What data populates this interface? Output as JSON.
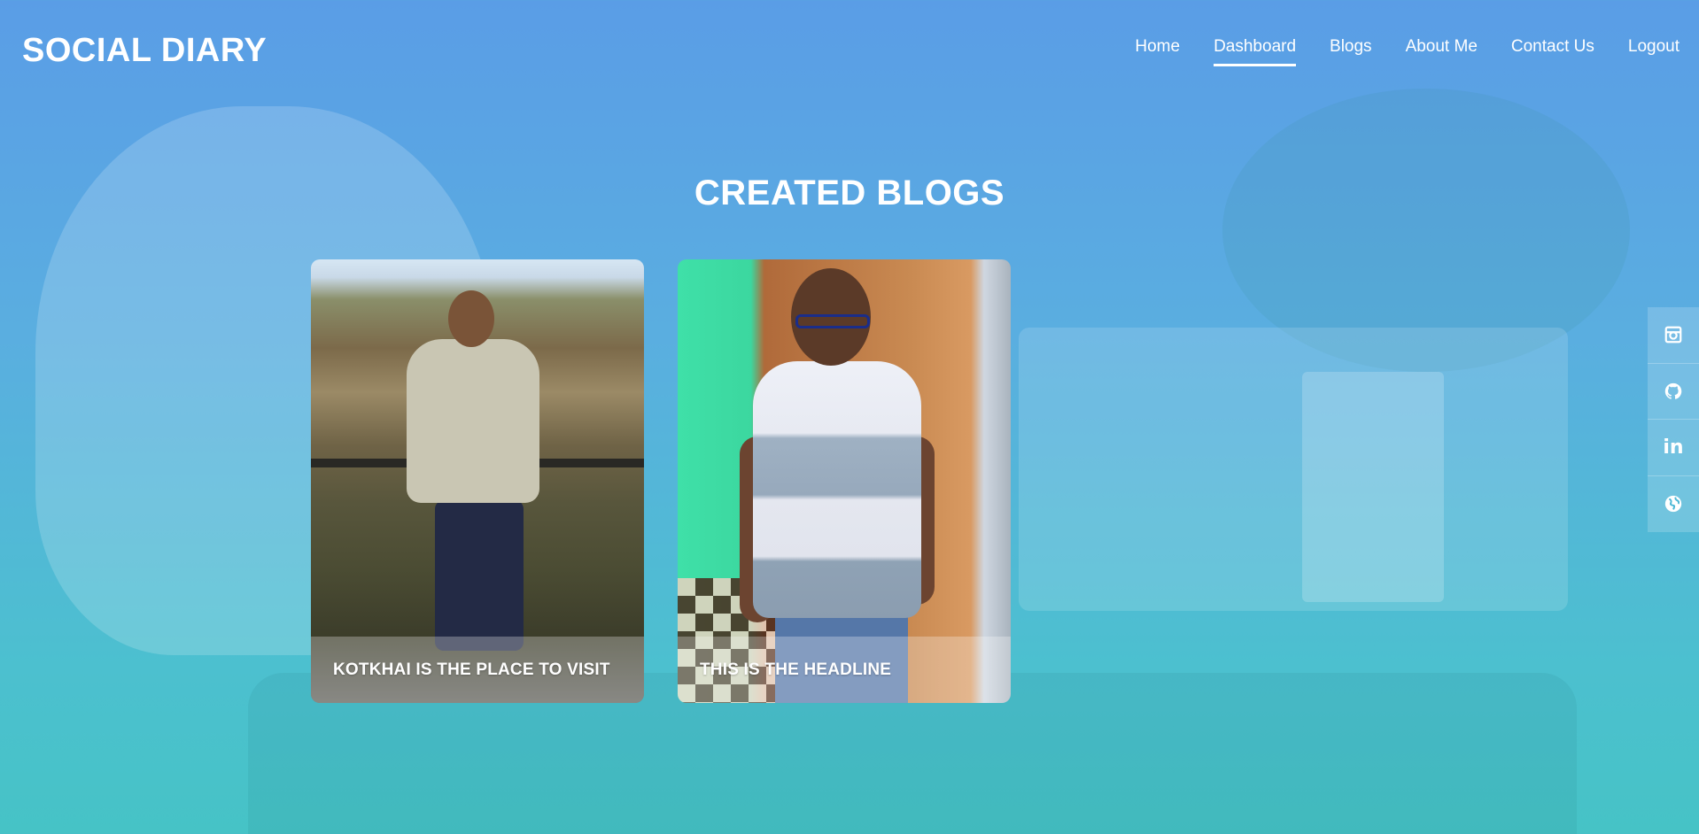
{
  "brand": {
    "title": "SOCIAL DIARY"
  },
  "nav": {
    "items": [
      {
        "label": "Home",
        "active": false
      },
      {
        "label": "Dashboard",
        "active": true
      },
      {
        "label": "Blogs",
        "active": false
      },
      {
        "label": "About Me",
        "active": false
      },
      {
        "label": "Contact Us",
        "active": false
      },
      {
        "label": "Logout",
        "active": false
      }
    ]
  },
  "main": {
    "title": "CREATED BLOGS",
    "blogs": [
      {
        "title": "KOTKHAI IS THE PLACE TO VISIT"
      },
      {
        "title": "THIS IS THE HEADLINE"
      }
    ]
  },
  "social": {
    "icons": [
      "instagram-icon",
      "github-icon",
      "linkedin-icon",
      "globe-icon"
    ],
    "linkedin_text": "in"
  },
  "colors": {
    "accent": "#ffffff",
    "background_top": "#5a9de6",
    "background_bottom": "#46c3c6"
  }
}
